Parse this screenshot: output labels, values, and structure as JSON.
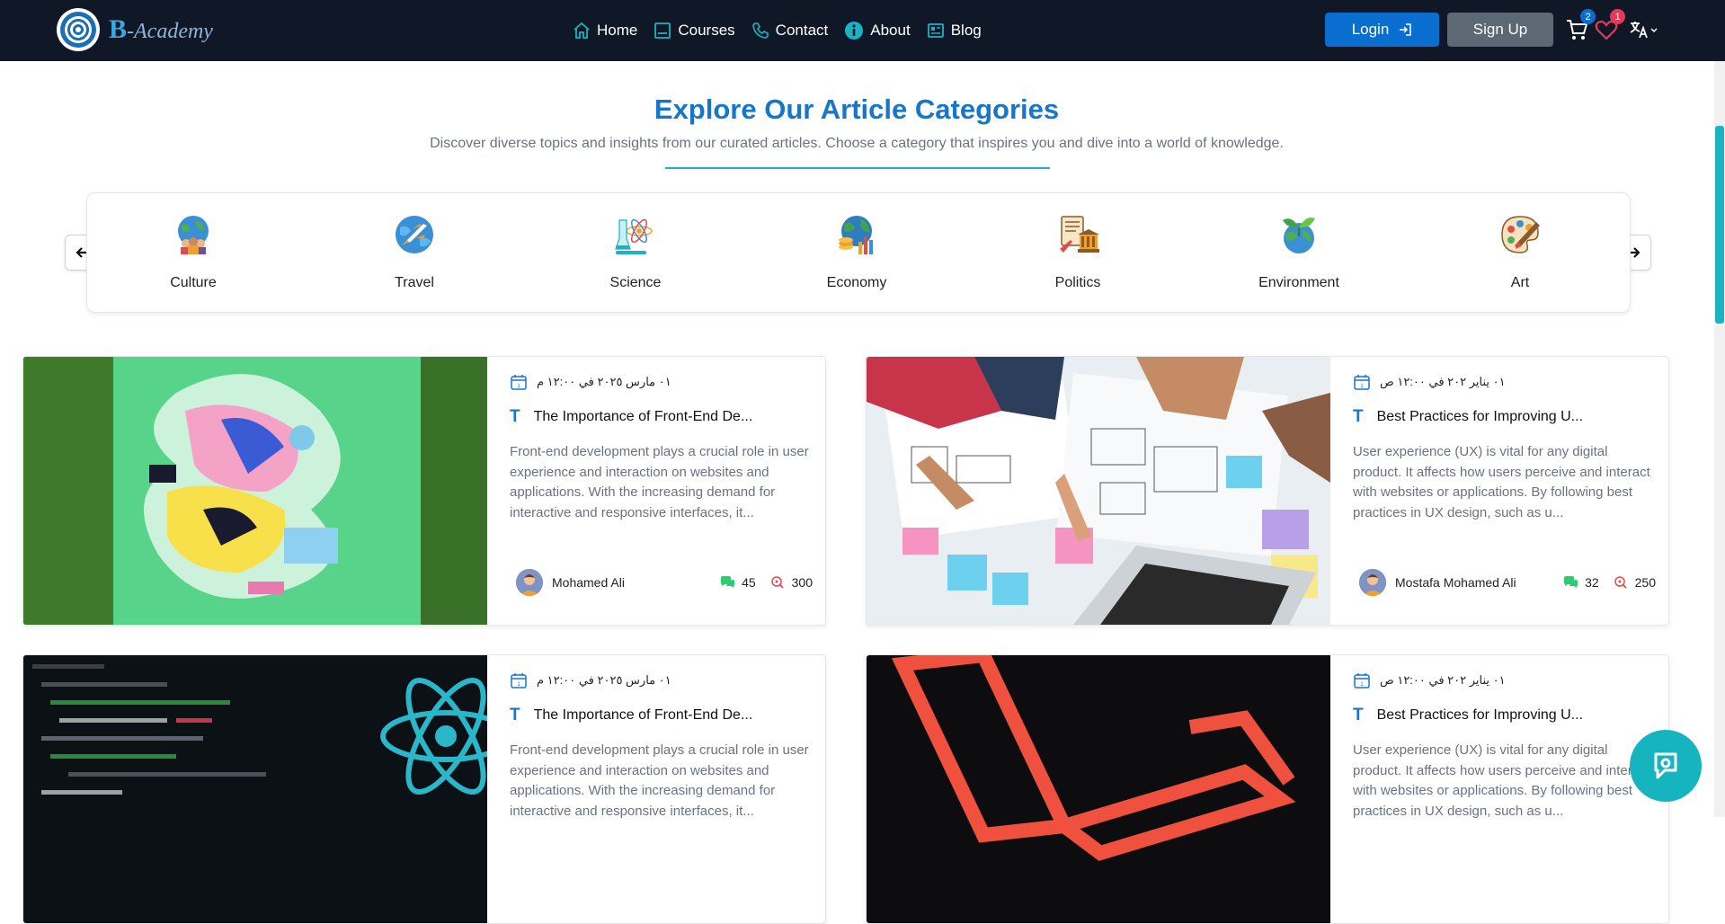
{
  "nav": {
    "logo_b": "B",
    "logo_rest": "-Academy",
    "menu": [
      {
        "label": "Home",
        "icon": "home-icon"
      },
      {
        "label": "Courses",
        "icon": "courses-icon"
      },
      {
        "label": "Contact",
        "icon": "phone-icon"
      },
      {
        "label": "About",
        "icon": "info-icon"
      },
      {
        "label": "Blog",
        "icon": "blog-icon"
      }
    ],
    "login_label": "Login",
    "signup_label": "Sign Up",
    "cart_count": "2",
    "wishlist_count": "1"
  },
  "header": {
    "title": "Explore Our Article Categories",
    "subtitle": "Discover diverse topics and insights from our curated articles. Choose a category that inspires you and dive into a world of knowledge."
  },
  "categories": [
    {
      "label": "Culture",
      "icon": "culture-icon"
    },
    {
      "label": "Travel",
      "icon": "travel-icon"
    },
    {
      "label": "Science",
      "icon": "science-icon"
    },
    {
      "label": "Economy",
      "icon": "economy-icon"
    },
    {
      "label": "Politics",
      "icon": "politics-icon"
    },
    {
      "label": "Environment",
      "icon": "environment-icon"
    },
    {
      "label": "Art",
      "icon": "art-icon"
    }
  ],
  "articles": [
    {
      "date": "٠١ مارس ٢٠٢٥ في ١٢:٠٠ م",
      "title": "The Importance of Front-End De...",
      "excerpt": "Front-end development plays a crucial role in user experience and interaction on websites and applications. With the increasing demand for interactive and responsive interfaces, it...",
      "author": "Mohamed Ali",
      "comments": "45",
      "views": "300"
    },
    {
      "date": "٠١ يناير ٢٠٢ في ١٢:٠٠ ص",
      "title": "Best Practices for Improving U...",
      "excerpt": "User experience (UX) is vital for any digital product. It affects how users perceive and interact with websites or applications. By following best practices in UX design, such as u...",
      "author": "Mostafa Mohamed Ali",
      "comments": "32",
      "views": "250"
    },
    {
      "date": "٠١ مارس ٢٠٢٥ في ١٢:٠٠ م",
      "title": "The Importance of Front-End De...",
      "excerpt": "Front-end development plays a crucial role in user experience and interaction on websites and applications. With the increasing demand for interactive and responsive interfaces, it...",
      "author": "",
      "comments": "",
      "views": ""
    },
    {
      "date": "٠١ يناير ٢٠٢ في ١٢:٠٠ ص",
      "title": "Best Practices for Improving U...",
      "excerpt": "User experience (UX) is vital for any digital product. It affects how users perceive and interact with websites or applications. By following best practices in UX design, such as u...",
      "author": "",
      "comments": "",
      "views": ""
    }
  ],
  "colors": {
    "nav_bg": "#101828",
    "primary": "#1477c9",
    "accent": "#1bb2c4",
    "login_bg": "#0a6ed1",
    "signup_bg": "#5d6875"
  }
}
